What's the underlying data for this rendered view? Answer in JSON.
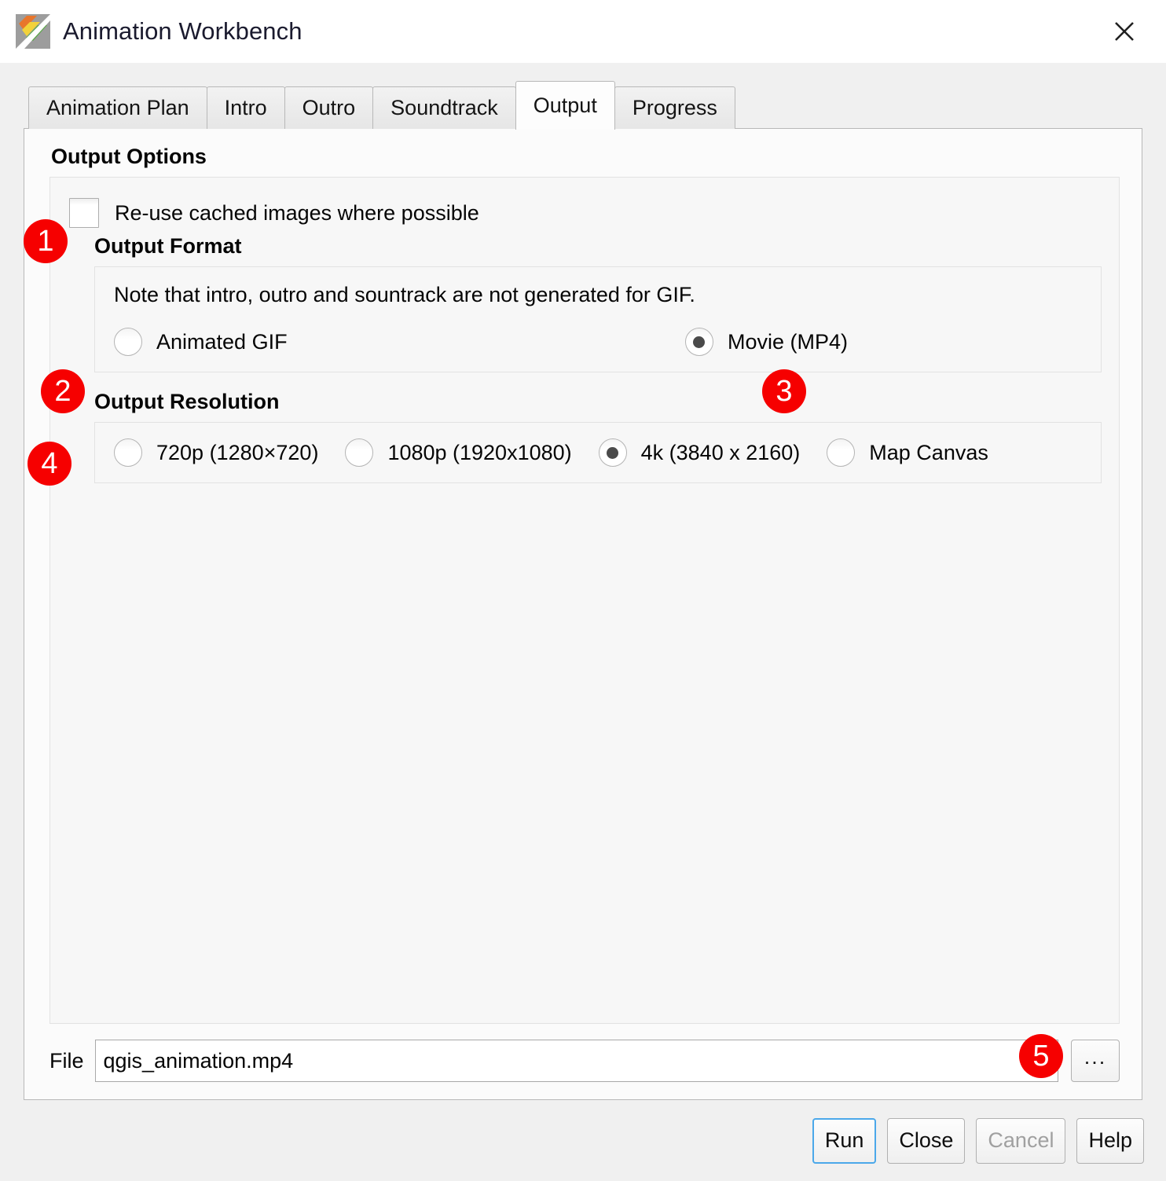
{
  "window": {
    "title": "Animation Workbench",
    "app_icon": "qgis-animation-workbench-logo-icon",
    "close_icon": "close-icon"
  },
  "tabs": [
    {
      "label": "Animation Plan",
      "active": false
    },
    {
      "label": "Intro",
      "active": false
    },
    {
      "label": "Outro",
      "active": false
    },
    {
      "label": "Soundtrack",
      "active": false
    },
    {
      "label": "Output",
      "active": true
    },
    {
      "label": "Progress",
      "active": false
    }
  ],
  "output_options": {
    "heading": "Output Options",
    "reuse_cache": {
      "label": "Re-use cached images where possible",
      "checked": false
    },
    "output_format": {
      "heading": "Output Format",
      "note": "Note that intro, outro and sountrack are not generated for GIF.",
      "options": [
        {
          "label": "Animated GIF",
          "selected": false
        },
        {
          "label": "Movie (MP4)",
          "selected": true
        }
      ]
    },
    "output_resolution": {
      "heading": "Output Resolution",
      "options": [
        {
          "label": "720p (1280×720)",
          "selected": false
        },
        {
          "label": "1080p (1920x1080)",
          "selected": false
        },
        {
          "label": "4k (3840 x 2160)",
          "selected": true
        },
        {
          "label": "Map Canvas",
          "selected": false
        }
      ]
    }
  },
  "file_row": {
    "label": "File",
    "value": "qgis_animation.mp4",
    "browse_label": "...",
    "browse_icon": "ellipsis-icon"
  },
  "buttons": [
    {
      "label": "Run",
      "state": "default"
    },
    {
      "label": "Close",
      "state": "normal"
    },
    {
      "label": "Cancel",
      "state": "disabled"
    },
    {
      "label": "Help",
      "state": "normal"
    }
  ],
  "annotations": [
    {
      "number": "1",
      "target": "reuse-cached-images-checkbox"
    },
    {
      "number": "2",
      "target": "animated-gif-radio"
    },
    {
      "number": "3",
      "target": "movie-mp4-radio"
    },
    {
      "number": "4",
      "target": "output-resolution-heading"
    },
    {
      "number": "5",
      "target": "file-browse-button"
    }
  ],
  "colors": {
    "annotation_badge": "#f60000",
    "default_button_focus": "#4ba8ea",
    "window_bg": "#f0f0f0",
    "panel_bg": "#fbfbfb"
  }
}
